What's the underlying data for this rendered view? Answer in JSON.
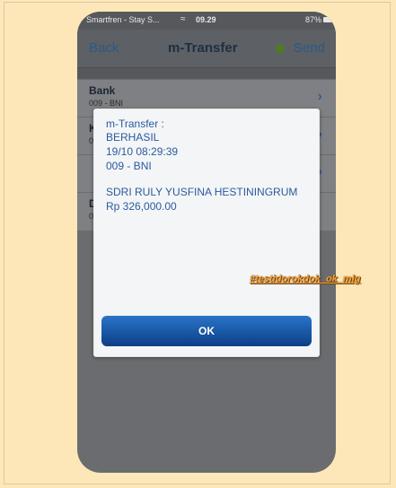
{
  "status_bar": {
    "carrier": "Smartfren - Stay S...",
    "time": "09.29",
    "battery": "87%"
  },
  "nav": {
    "back_label": "Back",
    "title": "m-Transfer",
    "send_label": "Send"
  },
  "form": {
    "rows": [
      {
        "label": "Bank",
        "value": "009 - BNI"
      },
      {
        "label": "K",
        "value": "0"
      },
      {
        "label": "",
        "value": ""
      },
      {
        "label": "D",
        "value": "0"
      }
    ]
  },
  "dialog": {
    "line1": "m-Transfer :",
    "line2": "BERHASIL",
    "line3": "19/10 08:29:39",
    "line4": "009 - BNI",
    "recipient": "SDRI RULY YUSFINA HESTININGRUM",
    "amount": "Rp 326,000.00",
    "ok_label": "OK"
  },
  "watermark": "#testidorokdok_ok_mlg",
  "colors": {
    "page_background": "#fde7b8",
    "dialog_text": "#285ba0",
    "ok_button": "#1a5aae",
    "send_indicator": "#4f7a25"
  }
}
